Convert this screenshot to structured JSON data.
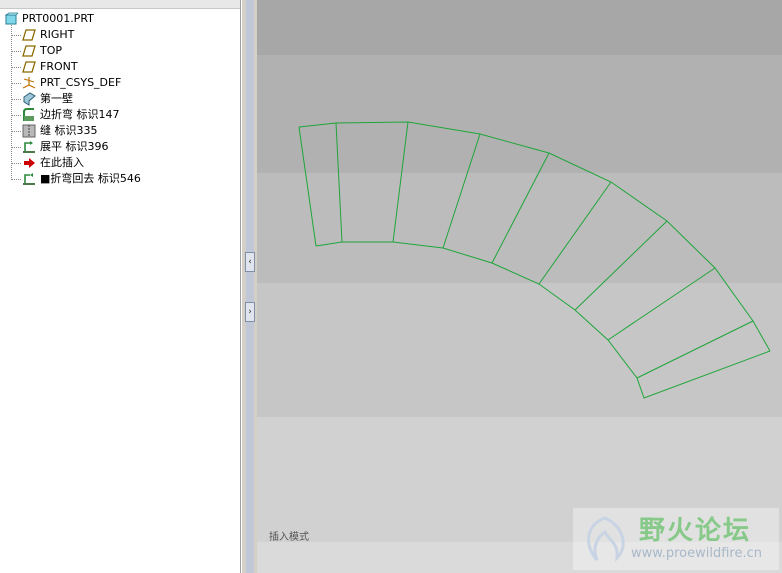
{
  "model_tree": {
    "root": {
      "label": "PRT0001.PRT",
      "icon": "part-icon"
    },
    "items": [
      {
        "label": "RIGHT",
        "icon": "datum-plane-icon"
      },
      {
        "label": "TOP",
        "icon": "datum-plane-icon"
      },
      {
        "label": "FRONT",
        "icon": "datum-plane-icon"
      },
      {
        "label": "PRT_CSYS_DEF",
        "icon": "coordinate-system-icon"
      },
      {
        "label": "第一壁",
        "icon": "sheetmetal-wall-icon"
      },
      {
        "label": "边折弯 标识147",
        "icon": "edge-bend-icon"
      },
      {
        "label": "缝 标识335",
        "icon": "rip-icon"
      },
      {
        "label": "展平 标识396",
        "icon": "unbend-icon"
      },
      {
        "label": "在此插入",
        "icon": "insert-here-arrow-icon"
      },
      {
        "label": "■折弯回去 标识546",
        "icon": "bend-back-icon"
      }
    ]
  },
  "splitter": {
    "collapse_label": "‹",
    "expand_label": "›"
  },
  "viewport": {
    "status_text": "插入模式"
  },
  "watermark": {
    "title": "野火论坛",
    "url": "www.proewildfire.cn"
  },
  "colors": {
    "geometry": "#1fa53a",
    "insert_arrow": "#cc0000"
  }
}
